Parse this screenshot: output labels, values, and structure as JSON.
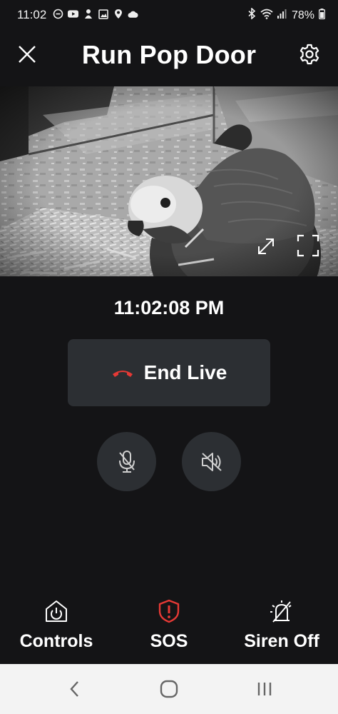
{
  "status_bar": {
    "time": "11:02",
    "battery": "78%",
    "left_icons": [
      "do-not-disturb-icon",
      "youtube-icon",
      "app-icon",
      "gallery-icon",
      "location-icon",
      "cloud-icon"
    ],
    "right_icons": [
      "bluetooth-icon",
      "wifi-icon",
      "signal-icon",
      "battery-icon"
    ]
  },
  "header": {
    "title": "Run Pop Door"
  },
  "live": {
    "timestamp": "11:02:08 PM",
    "end_label": "End Live"
  },
  "bottom_nav": {
    "controls_label": "Controls",
    "sos_label": "SOS",
    "siren_label": "Siren Off"
  },
  "colors": {
    "background": "#141416",
    "button": "#2c2f33",
    "accent_red": "#e53935",
    "system_nav": "#f3f3f3"
  }
}
